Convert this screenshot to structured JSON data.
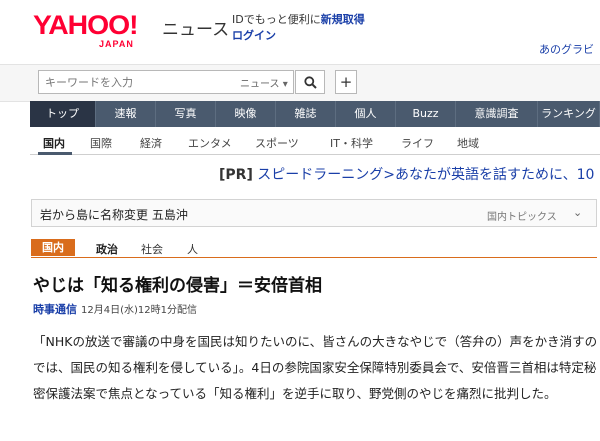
{
  "header": {
    "logo_text": "YAHOO!",
    "logo_sub": "JAPAN",
    "section_title": "ニュース",
    "id_promo_prefix": "IDでもっと便利に",
    "id_promo_link": "新規取得",
    "login_label": "ログイン",
    "right_link": "あのグラビ"
  },
  "search": {
    "placeholder": "キーワードを入力",
    "scope_label": "ニュース",
    "scope_icon": "triangle-down-icon",
    "search_icon": "search-icon",
    "plus_label": "+"
  },
  "main_nav": [
    "トップ",
    "速報",
    "写真",
    "映像",
    "雑誌",
    "個人",
    "Buzz",
    "意識調査",
    "ランキング"
  ],
  "sub_nav": [
    "国内",
    "国際",
    "経済",
    "エンタメ",
    "スポーツ",
    "IT・科学",
    "ライフ",
    "地域"
  ],
  "pr": {
    "prefix": "[PR]",
    "text": "スピードラーニング>あなたが英語を話すために、10"
  },
  "topics": {
    "headline": "岩から島に名称変更 五島沖",
    "label": "国内トピックス",
    "caret_icon": "chevron-down-icon"
  },
  "categories": {
    "tag": "国内",
    "items": [
      "政治",
      "社会",
      "人"
    ]
  },
  "article": {
    "headline": "やじは「知る権利の侵害」＝安倍首相",
    "source": "時事通信",
    "date": "12月4日(水)12時1分配信",
    "body": "「NHKの放送で審議の中身を国民は知りたいのに、皆さんの大きなやじで（答弁の）声をかき消すのでは、国民の知る権利を侵している」。4日の参院国家安全保障特別委員会で、安倍晋三首相は特定秘密保護法案で焦点となっている「知る権利」を逆手に取り、野党側のやじを痛烈に批判した。"
  },
  "colors": {
    "brand_red": "#ff0033",
    "nav_bg": "#4a5a6e",
    "nav_active": "#2a3445",
    "link_blue": "#1a3fa8",
    "tag_orange": "#d96c1c"
  }
}
